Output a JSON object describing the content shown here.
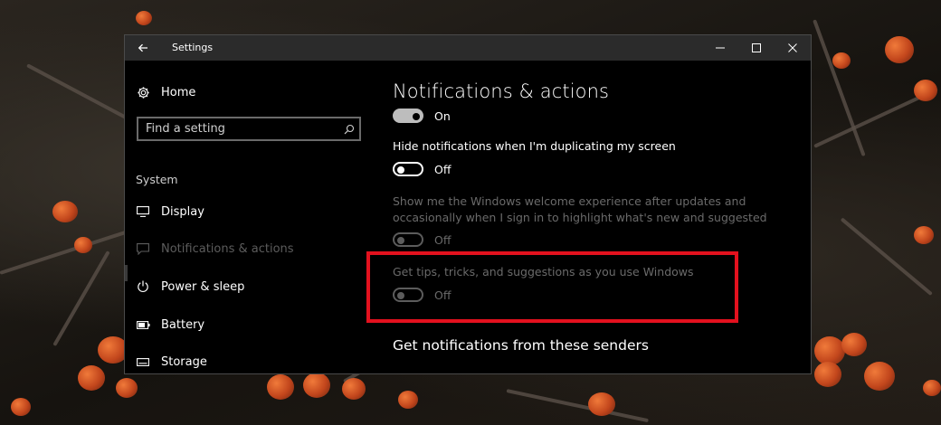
{
  "window": {
    "title": "Settings",
    "controls": {
      "minimize": "—",
      "maximize": "☐",
      "close": "✕"
    }
  },
  "sidebar": {
    "home_label": "Home",
    "search": {
      "placeholder": "Find a setting"
    },
    "section_label": "System",
    "items": [
      {
        "label": "Display",
        "icon": "monitor-icon"
      },
      {
        "label": "Notifications & actions",
        "icon": "message-icon",
        "state": "selected"
      },
      {
        "label": "Power & sleep",
        "icon": "power-icon"
      },
      {
        "label": "Battery",
        "icon": "battery-icon"
      },
      {
        "label": "Storage",
        "icon": "storage-icon"
      }
    ]
  },
  "content": {
    "title": "Notifications & actions",
    "settings": [
      {
        "label": "",
        "state": "On",
        "enabled": true
      },
      {
        "label": "Hide notifications when I'm duplicating my screen",
        "state": "Off",
        "enabled": true
      },
      {
        "label_line1": "Show me the Windows welcome experience after updates and",
        "label_line2": "occasionally when I sign in to highlight what's new and suggested",
        "state": "Off",
        "enabled": false
      },
      {
        "label": "Get tips, tricks, and suggestions as you use Windows",
        "state": "Off",
        "enabled": false
      }
    ],
    "senders_heading": "Get notifications from these senders"
  },
  "colors": {
    "highlight": "#e3111e",
    "window_bg": "#000000",
    "titlebar_bg": "#2b2b2b"
  }
}
